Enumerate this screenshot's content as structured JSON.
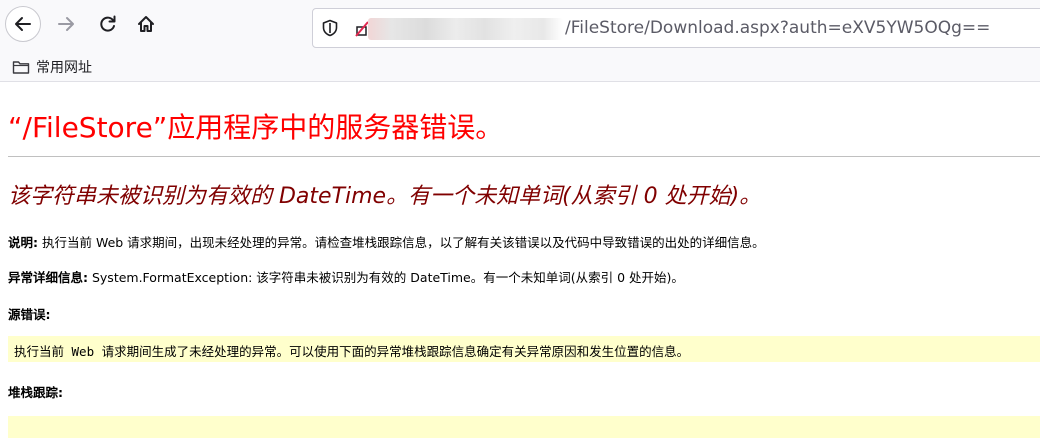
{
  "browser": {
    "url_visible": "/FileStore/Download.aspx?auth=eXV5YW5OQg==",
    "bookmarks": [
      {
        "label": "常用网址",
        "icon": "folder-icon"
      }
    ]
  },
  "page": {
    "title": "“/FileStore”应用程序中的服务器错误。",
    "error_message": "该字符串未被识别为有效的 DateTime。有一个未知单词(从索引 0 处开始)。",
    "description_label": "说明:",
    "description_text": " 执行当前 Web 请求期间，出现未经处理的异常。请检查堆栈跟踪信息，以了解有关该错误以及代码中导致错误的出处的详细信息。",
    "exception_label": "异常详细信息:",
    "exception_text": " System.FormatException: 该字符串未被识别为有效的 DateTime。有一个未知单词(从索引 0 处开始)。",
    "source_error_label": "源错误:",
    "source_error_text": "执行当前 Web 请求期间生成了未经处理的异常。可以使用下面的异常堆栈跟踪信息确定有关异常原因和发生位置的信息。",
    "stack_trace_label": "堆栈跟踪:"
  },
  "colors": {
    "title": "#ff0000",
    "error_message": "#800000",
    "highlight_bg": "#ffffcc"
  }
}
